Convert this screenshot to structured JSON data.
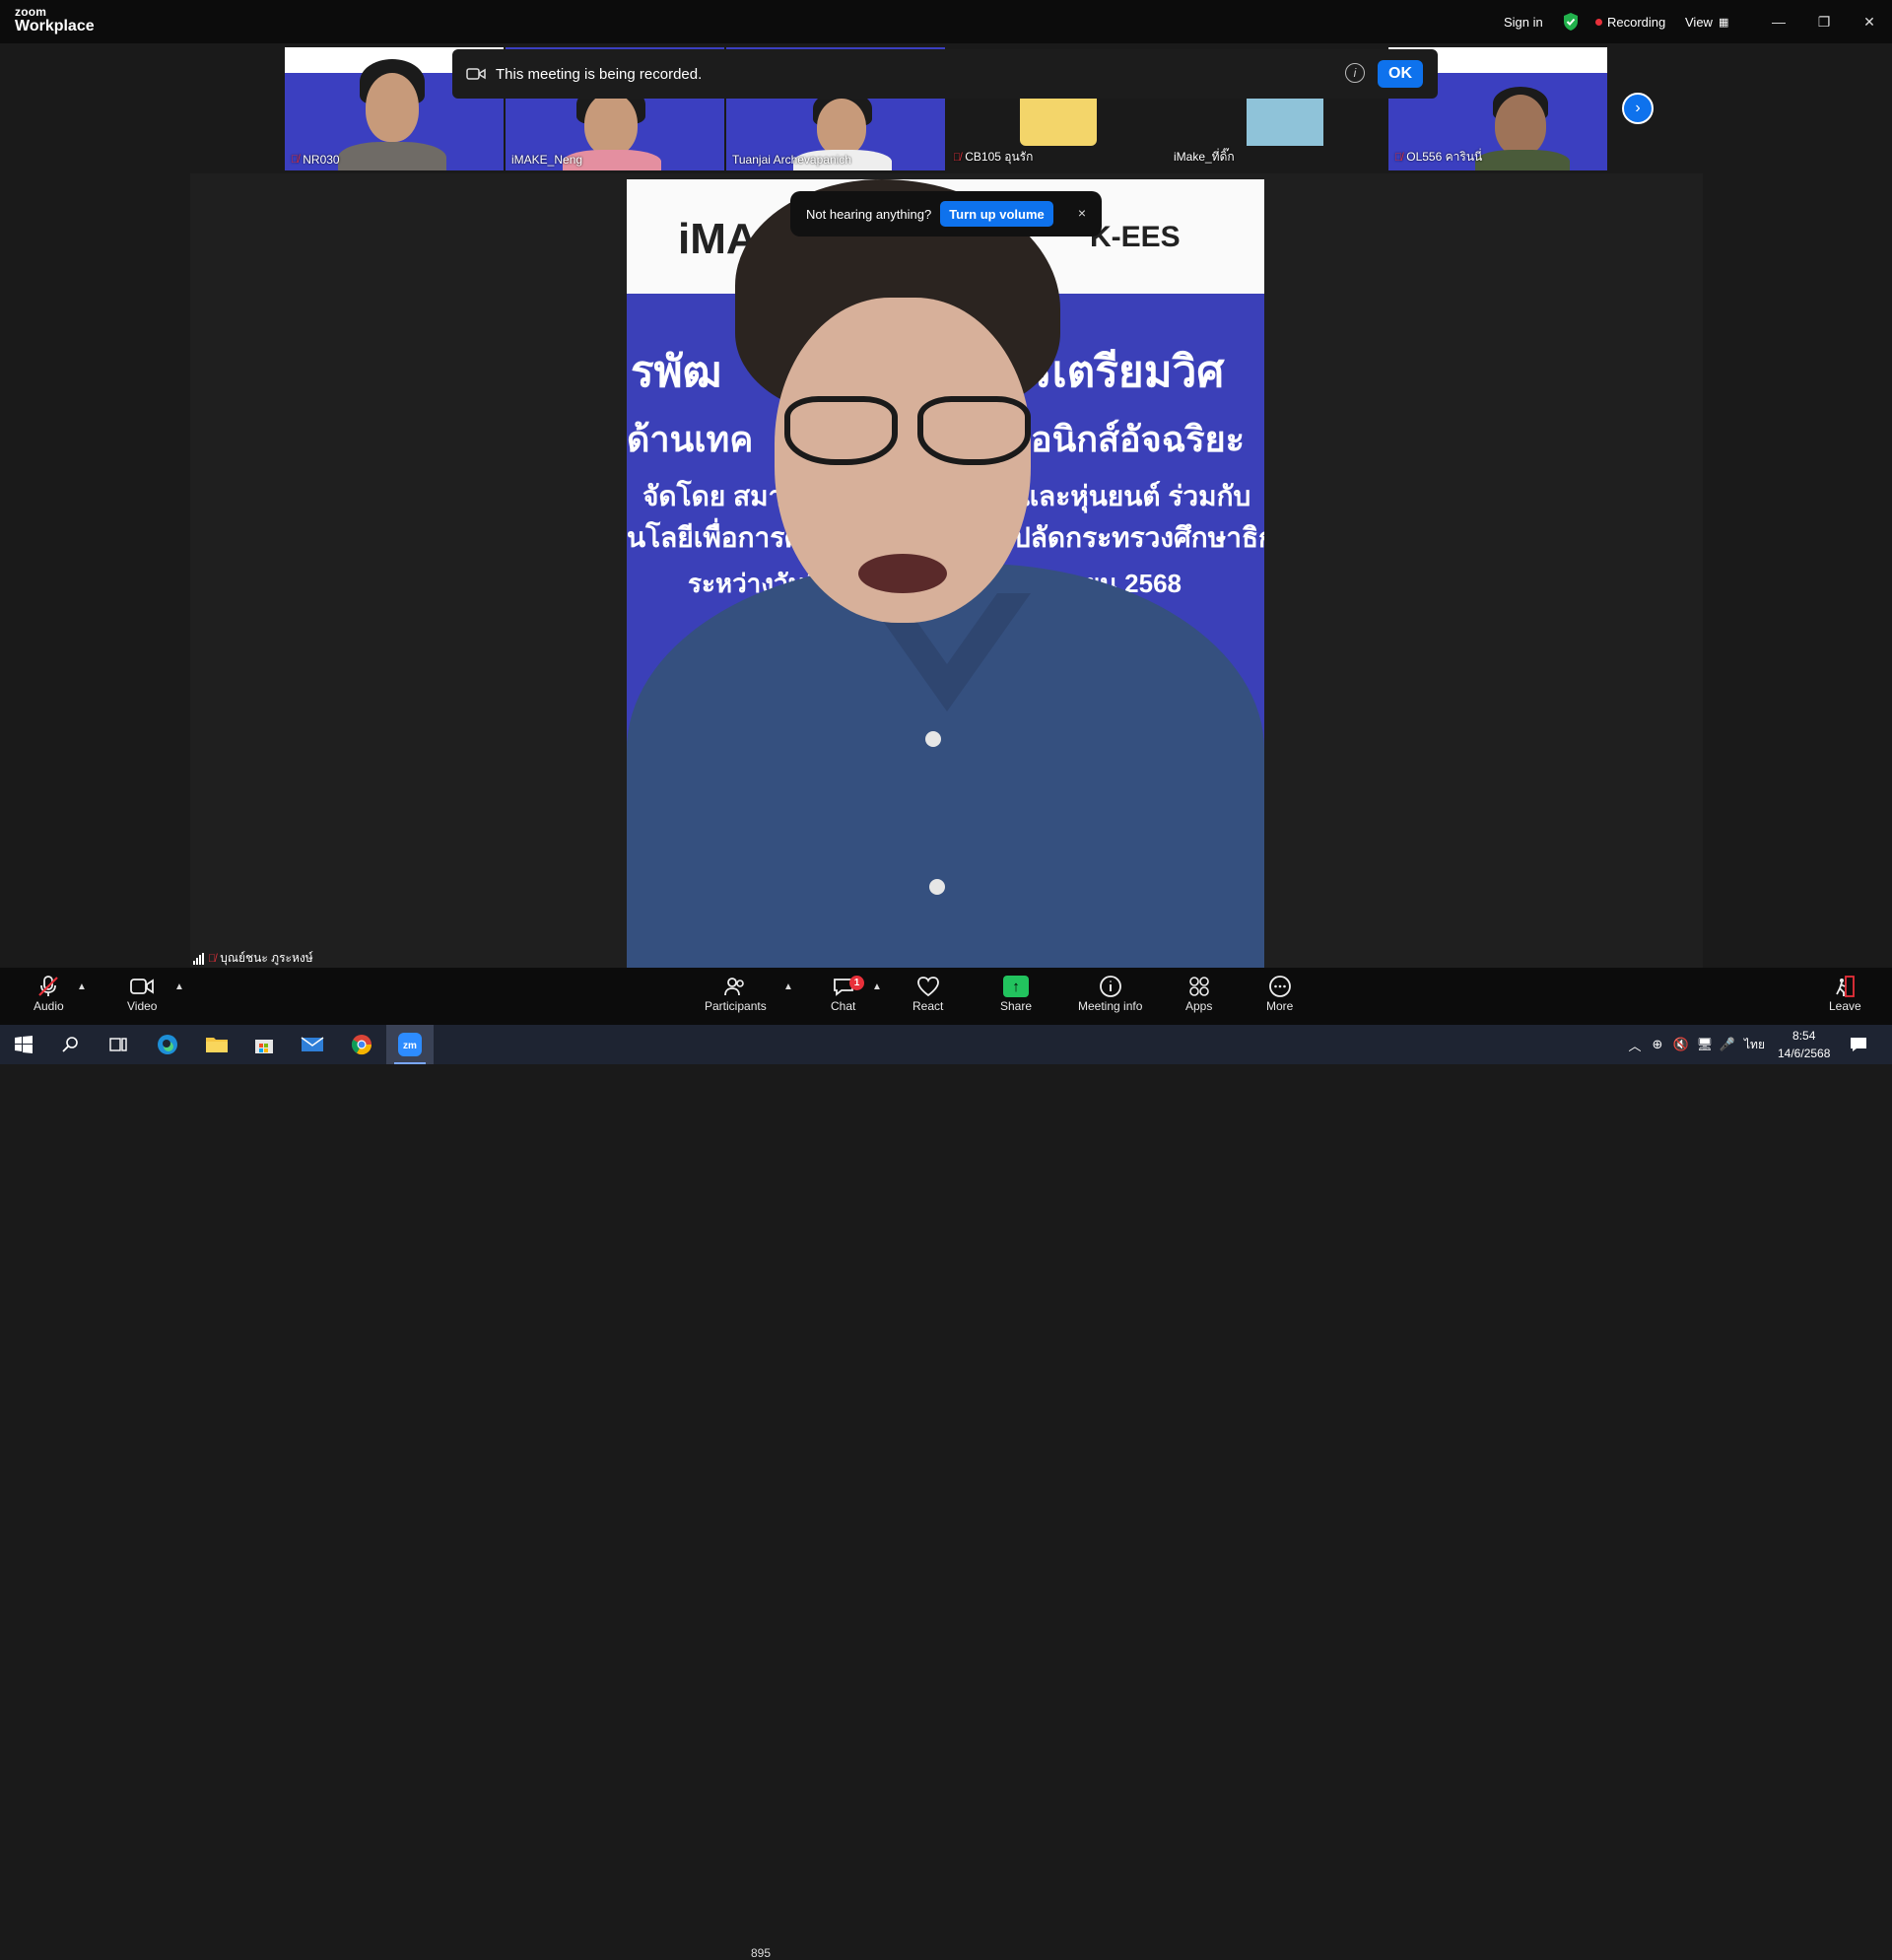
{
  "app": {
    "brand_top": "zoom",
    "brand_bottom": "Workplace"
  },
  "titlebar": {
    "signin": "Sign in",
    "recording": "Recording",
    "view": "View"
  },
  "recording_banner": {
    "text": "This meeting is being recorded.",
    "ok": "OK"
  },
  "thumbnails": [
    {
      "name": "NR030",
      "muted": true
    },
    {
      "name": "iMAKE_Neng",
      "muted": false
    },
    {
      "name": "Tuanjai Archevapanich",
      "muted": false
    },
    {
      "name": "CB105 อุนรัก",
      "muted": true
    },
    {
      "name": "iMake_ที่ดิ๊ก",
      "muted": false
    },
    {
      "name": "OL556 คารินนี่",
      "muted": true
    }
  ],
  "toast": {
    "text": "Not hearing anything?",
    "button": "Turn up volume",
    "close": "×"
  },
  "video_slide": {
    "logo_left": "iMA",
    "logo_right": "K-EES",
    "line1": "รพัฒ",
    "line1b": "รเตรียมวิศ",
    "line2": "ด้านเทค",
    "line2b": "อนิกส์อัจฉริยะ",
    "line3": "จัดโดย สมา",
    "line3b": "และหุ่นยนต์ ร่วมกับ",
    "line4": "นโลยีเพื่อการศึ",
    "line4b": "ปลัดกระทรวงศึกษาธิก",
    "line5": "ระหว่างวันที่",
    "line5b": "2 มิถุนายน 2568"
  },
  "active_speaker": {
    "name": "บุณย์ชนะ ภูระหงษ์"
  },
  "toolbar": {
    "audio": "Audio",
    "video": "Video",
    "participants": "Participants",
    "participants_count": "895",
    "chat": "Chat",
    "chat_badge": "1",
    "react": "React",
    "share": "Share",
    "meeting_info": "Meeting info",
    "apps": "Apps",
    "more": "More",
    "leave": "Leave"
  },
  "taskbar": {
    "lang": "ไทย",
    "time": "8:54",
    "date": "14/6/2568"
  },
  "colors": {
    "accent": "#0e72ed",
    "record": "#e8303a",
    "share": "#22c35e"
  }
}
